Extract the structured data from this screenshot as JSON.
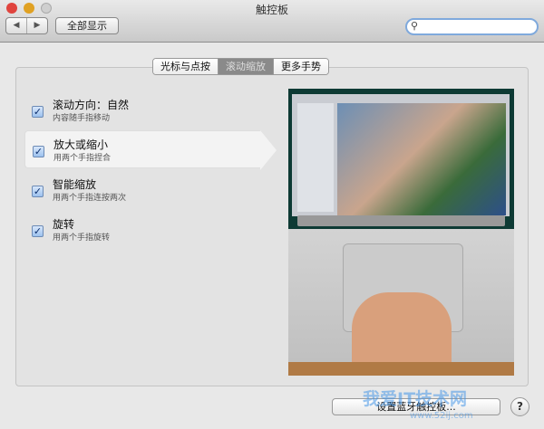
{
  "window": {
    "title": "触控板"
  },
  "toolbar": {
    "back": "◀",
    "forward": "▶",
    "show_all": "全部显示",
    "search_icon": "⚲",
    "search_placeholder": ""
  },
  "tabs": [
    {
      "label": "光标与点按"
    },
    {
      "label": "滚动缩放",
      "active": true
    },
    {
      "label": "更多手势"
    }
  ],
  "options": [
    {
      "label": "滚动方向：自然",
      "sub": "内容随手指移动",
      "checked": true
    },
    {
      "label": "放大或缩小",
      "sub": "用两个手指捏合",
      "checked": true,
      "selected": true
    },
    {
      "label": "智能缩放",
      "sub": "用两个手指连按两次",
      "checked": true
    },
    {
      "label": "旋转",
      "sub": "用两个手指旋转",
      "checked": true
    }
  ],
  "check_glyph": "✓",
  "footer": {
    "bluetooth_button": "设置蓝牙触控板...",
    "help": "?"
  },
  "watermark": {
    "text": "我爱IT技术网",
    "url": "www.52ij.com"
  }
}
